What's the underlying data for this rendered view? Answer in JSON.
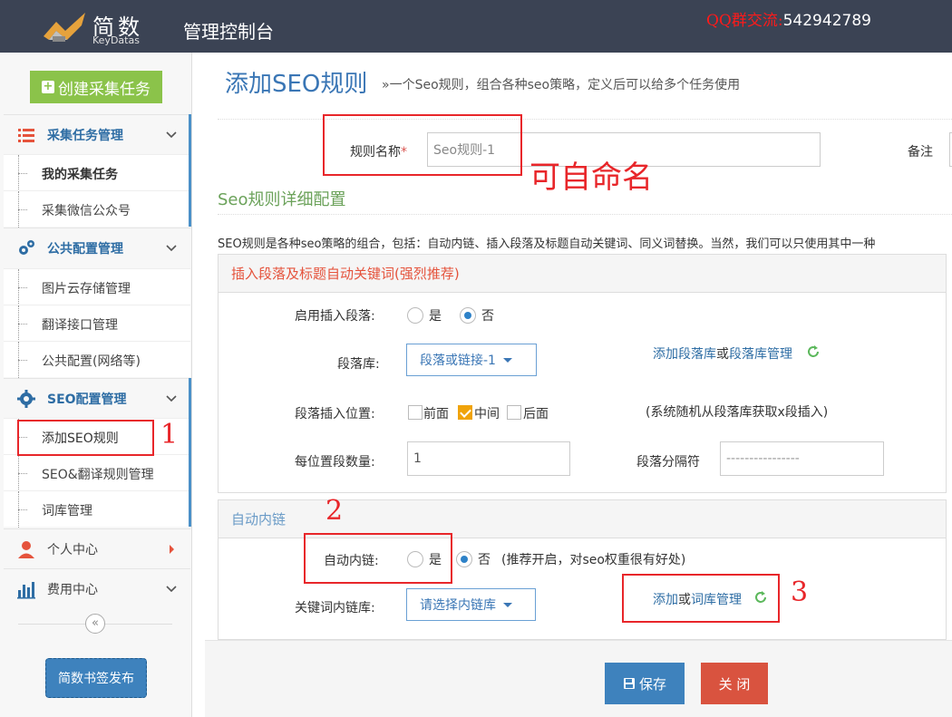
{
  "header": {
    "logo_cn": "简数",
    "logo_en": "KeyDatas",
    "console_title": "管理控制台",
    "qq_label": "QQ群交流:",
    "qq_number": "542942789"
  },
  "sidebar": {
    "create_button": "创建采集任务",
    "groups": [
      {
        "label": "采集任务管理",
        "icon": "list-icon"
      },
      {
        "label": "公共配置管理",
        "icon": "gears-icon"
      },
      {
        "label": "SEO配置管理",
        "icon": "gear-icon"
      },
      {
        "label": "个人中心",
        "icon": "user-icon"
      },
      {
        "label": "费用中心",
        "icon": "bar-chart-icon"
      }
    ],
    "items": [
      "我的采集任务",
      "采集微信公众号",
      "图片云存储管理",
      "翻译接口管理",
      "公共配置(网络等)",
      "添加SEO规则",
      "SEO&翻译规则管理",
      "词库管理"
    ],
    "bookmark_button": "简数书签发布"
  },
  "main": {
    "title": "添加SEO规则",
    "subtitle": "»一个Seo规则，组合各种seo策略，定义后可以给多个任务使用",
    "rule_name_label": "规则名称",
    "rule_name_value": "Seo规则-1",
    "remark_label": "备注",
    "section_title": "Seo规则详细配置",
    "description": "SEO规则是各种seo策略的组合，包括：自动内链、插入段落及标题自动关键词、同义词替换。当然，我们可以只使用其中一种",
    "panel1": {
      "title": "插入段落及标题自动关键词(强烈推荐)",
      "enable_label": "启用插入段落:",
      "yes": "是",
      "no": "否",
      "library_label": "段落库:",
      "library_value": "段落或链接-1",
      "add_library": "添加段落库",
      "or": "或",
      "manage_library": "段落库管理",
      "position_label": "段落插入位置:",
      "pos_front": "前面",
      "pos_middle": "中间",
      "pos_back": "后面",
      "position_note": "(系统随机从段落库获取x段插入)",
      "count_label": "每位置段数量:",
      "count_value": "1",
      "separator_label": "段落分隔符",
      "separator_value": "----------------"
    },
    "panel2": {
      "title": "自动内链",
      "auto_link_label": "自动内链:",
      "yes": "是",
      "no": "否",
      "note": "(推荐开启，对seo权重很有好处)",
      "keyword_lib_label": "关键词内链库:",
      "keyword_lib_value": "请选择内链库",
      "add": "添加",
      "or": "或",
      "manage": "词库管理"
    },
    "save_button": "保存",
    "close_button": "关 闭"
  },
  "annotations": {
    "note_text": "可自命名",
    "num1": "1",
    "num2": "2",
    "num3": "3"
  },
  "colors": {
    "header_bg": "#3b4354",
    "accent_blue": "#3e82bd",
    "green_button": "#8bc34a",
    "close_red": "#d9533f",
    "annotation_red": "#e8262a"
  }
}
